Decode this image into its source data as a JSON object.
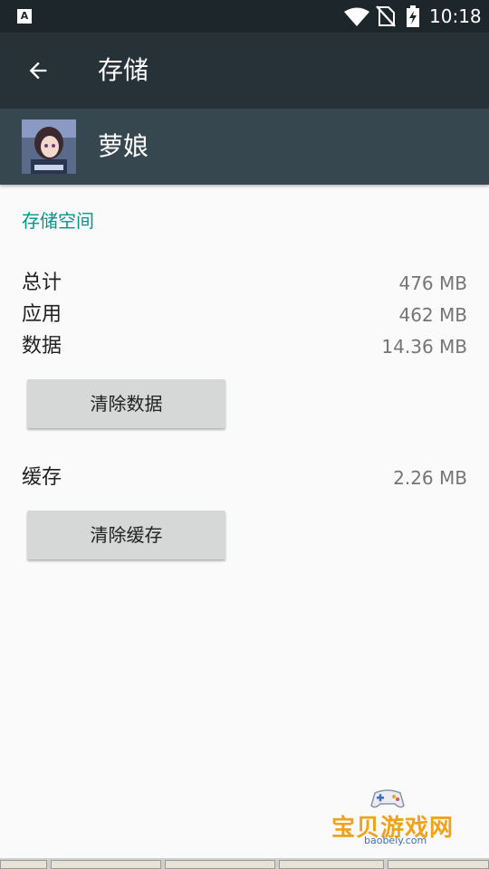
{
  "status_bar": {
    "time": "10:18",
    "left_icon_glyph": "A",
    "icons": [
      "a-notification-icon",
      "wifi-icon",
      "no-sim-icon",
      "battery-charging-icon"
    ]
  },
  "app_bar": {
    "title": "存储",
    "back_icon": "arrow-back-icon"
  },
  "app_header": {
    "app_name": "萝娘",
    "avatar_icon": "app-icon"
  },
  "storage": {
    "section_title": "存储空间",
    "rows": [
      {
        "label": "总计",
        "value": "476 MB"
      },
      {
        "label": "应用",
        "value": "462 MB"
      },
      {
        "label": "数据",
        "value": "14.36 MB"
      }
    ],
    "clear_data_button": "清除数据",
    "cache": {
      "label": "缓存",
      "value": "2.26 MB"
    },
    "clear_cache_button": "清除缓存"
  },
  "watermark": {
    "title": "宝贝游戏网",
    "url": "baobeiy.com"
  },
  "colors": {
    "status_bar": "#1c262b",
    "app_bar": "#263238",
    "app_header": "#37474f",
    "accent": "#009688",
    "background": "#fafafa",
    "button": "#d6d7d7"
  }
}
